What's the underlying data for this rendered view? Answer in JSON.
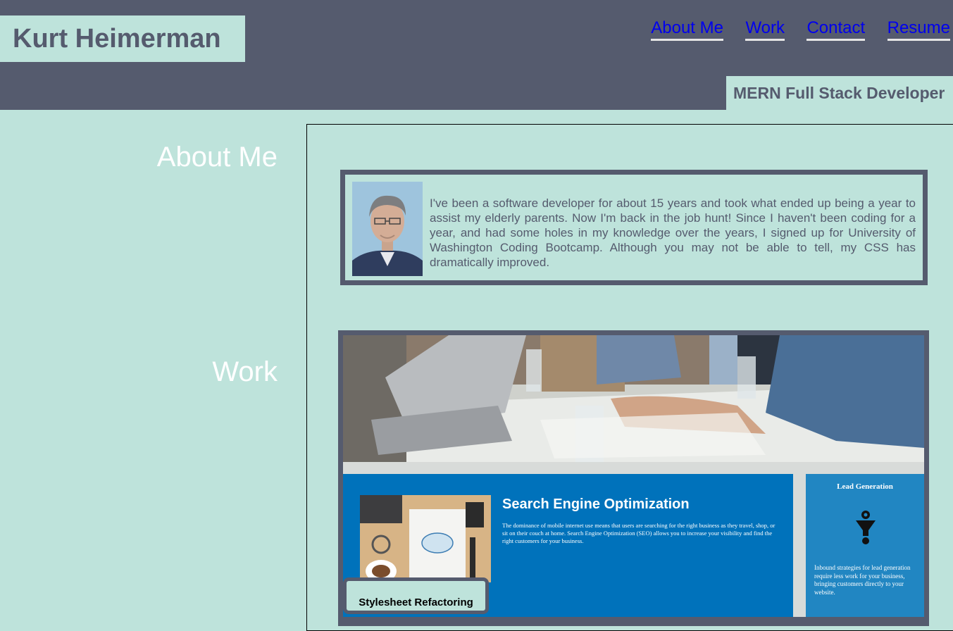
{
  "header": {
    "title": "Kurt Heimerman",
    "subtitle": "MERN Full Stack Developer",
    "nav": [
      "About Me",
      "Work",
      "Contact",
      "Resume"
    ]
  },
  "sections": {
    "about_heading": "About Me",
    "work_heading": "Work"
  },
  "about": {
    "text": "I've been a software developer for about 15 years and took what ended up being a year to assist my elderly parents. Now I'm back in the job hunt! Since I haven't been coding for a year, and had some holes in my knowledge over the years, I signed up for University of Washington Coding Bootcamp. Although you may not be able to tell, my CSS has dramatically improved."
  },
  "work": {
    "project_label": "Stylesheet Refactoring",
    "screenshot": {
      "seo_title": "Search Engine Optimization",
      "seo_text": "The dominance of mobile internet use means that users are searching for the right business as they travel, shop, or sit on their couch at home. Search Engine Optimization (SEO) allows you to increase your visibility and find the right customers for your business.",
      "lead_title": "Lead Generation",
      "lead_text": "Inbound strategies for lead generation require less work for your business, bringing customers directly to your website."
    }
  },
  "colors": {
    "primary": "#555b6e",
    "background": "#bee3db",
    "link": "#0000ee",
    "heading_text": "#ffffff"
  },
  "icons": [
    "profile-photo",
    "meeting-photo",
    "seo-thumbnail",
    "funnel-gear-icon"
  ]
}
